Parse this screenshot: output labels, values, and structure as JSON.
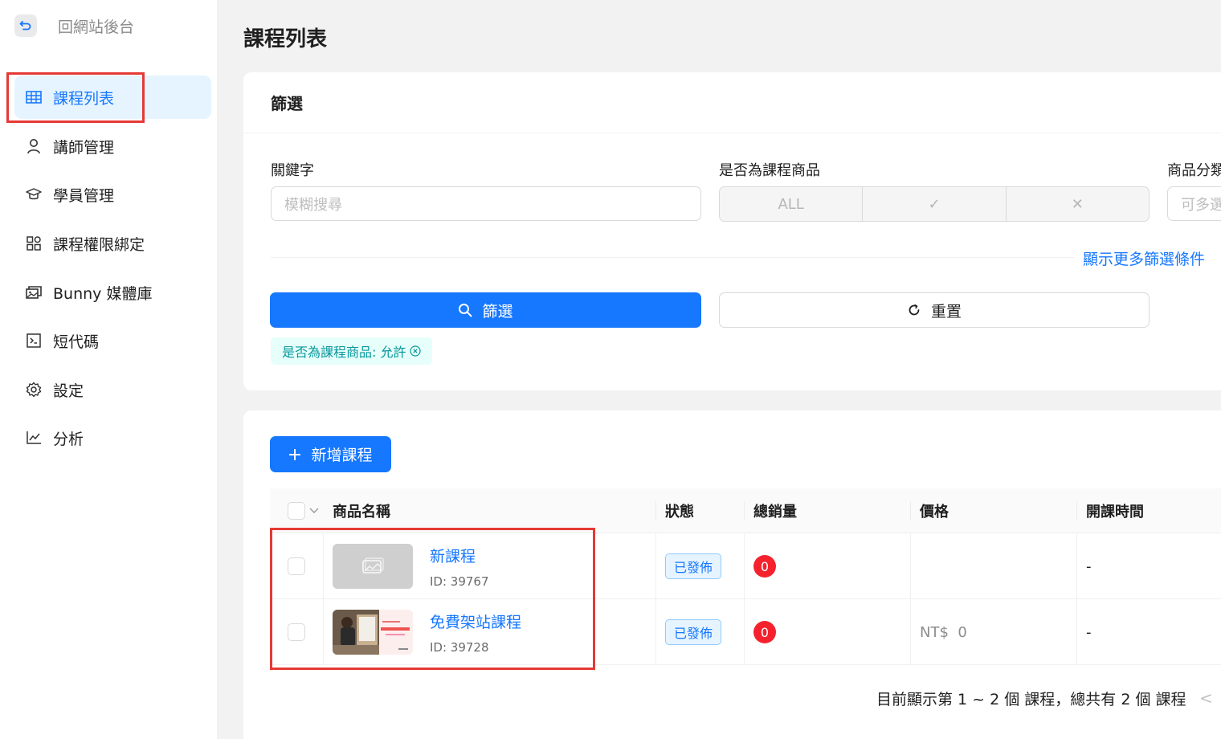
{
  "sidebar": {
    "back_label": "回網站後台",
    "items": [
      {
        "label": "課程列表",
        "icon": "table-icon",
        "active": true
      },
      {
        "label": "講師管理",
        "icon": "user-icon"
      },
      {
        "label": "學員管理",
        "icon": "graduation-cap-icon"
      },
      {
        "label": "課程權限綁定",
        "icon": "apps-icon"
      },
      {
        "label": "Bunny 媒體庫",
        "icon": "media-library-icon"
      },
      {
        "label": "短代碼",
        "icon": "code-icon"
      },
      {
        "label": "設定",
        "icon": "gear-icon"
      },
      {
        "label": "分析",
        "icon": "line-chart-icon"
      }
    ]
  },
  "page": {
    "title": "課程列表"
  },
  "filter": {
    "title": "篩選",
    "keyword_label": "關鍵字",
    "keyword_placeholder": "模糊搜尋",
    "is_course_label": "是否為課程商品",
    "segment": {
      "all": "ALL",
      "yes": "✓",
      "no": "✕"
    },
    "category_label": "商品分類",
    "category_placeholder": "可多選",
    "more_link": "顯示更多篩選條件",
    "filter_button": "篩選",
    "reset_button": "重置",
    "active_tag": "是否為課程商品: 允許"
  },
  "table": {
    "add_button": "新增課程",
    "columns": [
      "商品名稱",
      "狀態",
      "總銷量",
      "價格",
      "開課時間"
    ],
    "rows": [
      {
        "name": "新課程",
        "id": "ID: 39767",
        "status": "已發佈",
        "sales": "0",
        "price": "",
        "start": "-"
      },
      {
        "name": "免費架站課程",
        "id": "ID: 39728",
        "status": "已發佈",
        "sales": "0",
        "price": "NT$  0",
        "start": "-"
      }
    ],
    "pagination": "目前顯示第 1 ~ 2 個 課程，總共有 2 個 課程"
  },
  "colors": {
    "primary": "#1677ff",
    "highlight": "#e53935",
    "badge": "#f5222d",
    "tag": "#08979c"
  }
}
